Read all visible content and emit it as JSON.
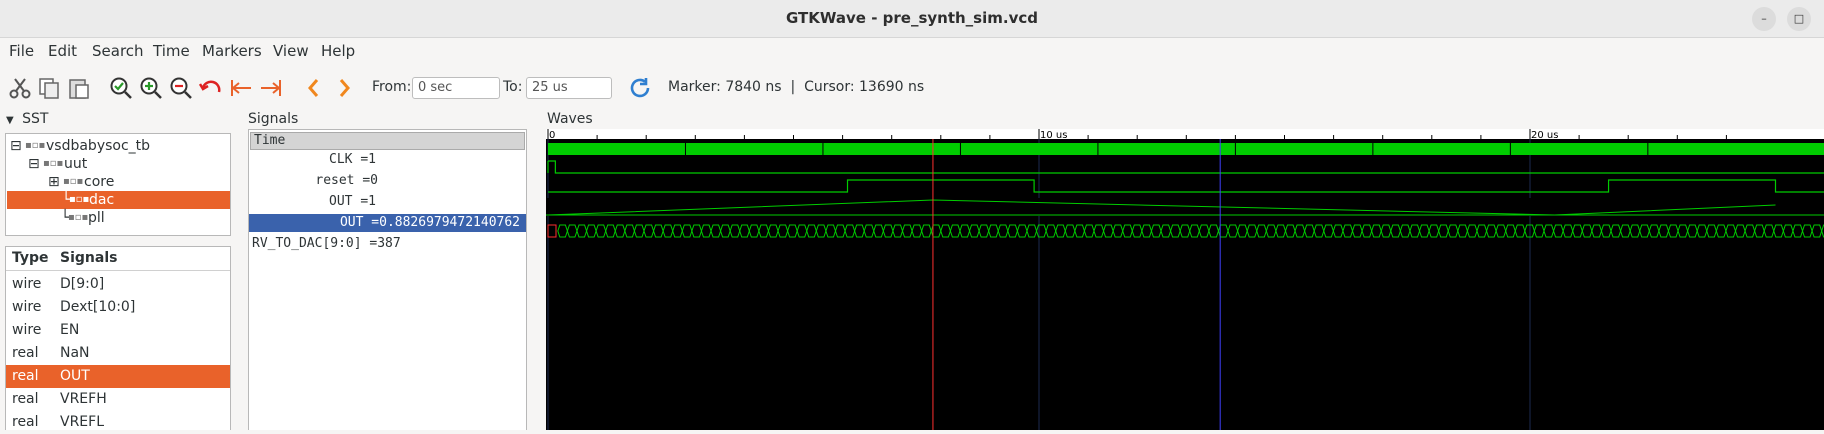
{
  "window": {
    "title": "GTKWave - pre_synth_sim.vcd",
    "minimize_glyph": "–",
    "maximize_glyph": "□"
  },
  "menu": [
    "File",
    "Edit",
    "Search",
    "Time",
    "Markers",
    "View",
    "Help"
  ],
  "toolbar": {
    "icons": [
      "cut-icon",
      "copy-icon",
      "paste-icon",
      "zoom-fit-icon",
      "zoom-in-icon",
      "zoom-out-icon",
      "undo-zoom-icon",
      "zoom-to-start-icon",
      "zoom-to-end-icon",
      "previous-edge-icon",
      "next-edge-icon"
    ],
    "from_label": "From:",
    "from_value": "0 sec",
    "to_label": "To:",
    "to_value": "25 us",
    "reload_icon": "reload-icon",
    "marker_text": "Marker: 7840 ns  |  Cursor: 13690 ns"
  },
  "sst": {
    "title": "SST",
    "tree": [
      {
        "label": "vsdbabysoc_tb",
        "expander": "⊟",
        "selected": false
      },
      {
        "label": "uut",
        "expander": "⊟",
        "selected": false
      },
      {
        "label": "core",
        "expander": "⊞",
        "selected": false
      },
      {
        "label": "dac",
        "expander": "",
        "selected": true
      },
      {
        "label": "pll",
        "expander": "",
        "selected": false
      }
    ],
    "columns": [
      "Type",
      "Signals"
    ],
    "rows": [
      {
        "type": "wire",
        "name": "D[9:0]",
        "selected": false
      },
      {
        "type": "wire",
        "name": "Dext[10:0]",
        "selected": false
      },
      {
        "type": "wire",
        "name": "EN",
        "selected": false
      },
      {
        "type": "real",
        "name": "NaN",
        "selected": false
      },
      {
        "type": "real",
        "name": "OUT",
        "selected": true
      },
      {
        "type": "real",
        "name": "VREFH",
        "selected": false
      },
      {
        "type": "real",
        "name": "VREFL",
        "selected": false
      }
    ]
  },
  "signals": {
    "title": "Signals",
    "header": "Time",
    "rows": [
      {
        "text": "CLK =1",
        "align": "right",
        "selected": false
      },
      {
        "text": "reset =0",
        "align": "right",
        "selected": false
      },
      {
        "text": "OUT =1",
        "align": "right",
        "selected": false
      },
      {
        "text": "OUT =0.8826979472140762",
        "align": "right",
        "selected": true
      },
      {
        "text": "RV_TO_DAC[9:0] =387",
        "align": "left",
        "selected": false
      }
    ]
  },
  "waves": {
    "title": "Waves",
    "time_range_us": [
      0,
      25
    ],
    "ticks": [
      {
        "t_us": 0,
        "label": "0"
      },
      {
        "t_us": 10,
        "label": "10 us"
      },
      {
        "t_us": 20,
        "label": "20 us"
      }
    ],
    "marker_us": 7.84,
    "cursor_us": 13.69,
    "out_digital_high_intervals_us": [
      [
        6.1,
        9.9
      ],
      [
        21.6,
        25
      ]
    ],
    "colors": {
      "trace": "#00cc00",
      "marker": "#ff3030",
      "cursor": "#4040ff",
      "selected": "#3a62ac",
      "accent": "#e9622a"
    }
  }
}
